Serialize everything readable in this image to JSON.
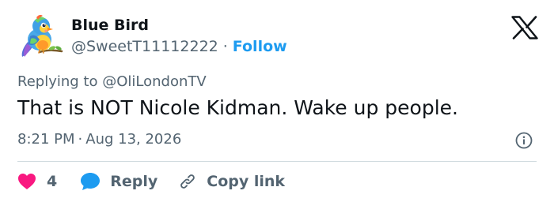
{
  "author": {
    "display_name": "Blue Bird",
    "handle": "@SweetT11112222",
    "separator": "·",
    "follow_label": "Follow"
  },
  "reply_context": {
    "prefix": "Replying to",
    "mention": "@OliLondonTV"
  },
  "tweet": {
    "text": "That is NOT Nicole Kidman. Wake up people.",
    "time": "8:21 PM",
    "separator": "·",
    "date": "Aug 13, 2026"
  },
  "actions": {
    "like_count": "4",
    "reply_label": "Reply",
    "copy_link_label": "Copy link"
  },
  "icons": {
    "brand": "x-logo-icon",
    "info": "info-icon",
    "like": "heart-icon",
    "reply": "speech-bubble-icon",
    "copy": "link-icon"
  },
  "colors": {
    "text_primary": "#0f1419",
    "text_secondary": "#536471",
    "link": "#1d9bf0",
    "like": "#f91880",
    "reply": "#1d9bf0",
    "divider": "#cfd9de"
  }
}
